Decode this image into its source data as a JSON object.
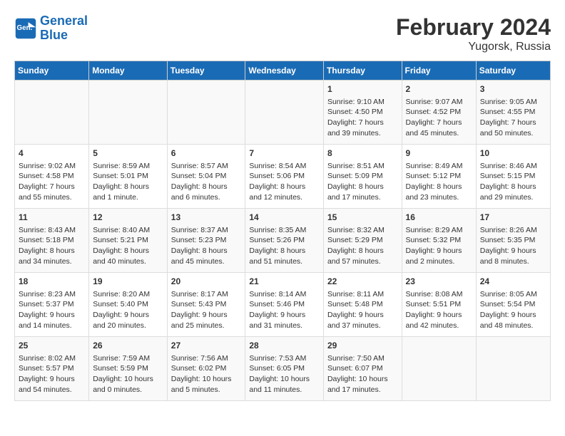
{
  "header": {
    "logo_line1": "General",
    "logo_line2": "Blue",
    "title": "February 2024",
    "subtitle": "Yugorsk, Russia"
  },
  "days_of_week": [
    "Sunday",
    "Monday",
    "Tuesday",
    "Wednesday",
    "Thursday",
    "Friday",
    "Saturday"
  ],
  "weeks": [
    [
      {
        "day": "",
        "info": ""
      },
      {
        "day": "",
        "info": ""
      },
      {
        "day": "",
        "info": ""
      },
      {
        "day": "",
        "info": ""
      },
      {
        "day": "1",
        "info": "Sunrise: 9:10 AM\nSunset: 4:50 PM\nDaylight: 7 hours\nand 39 minutes."
      },
      {
        "day": "2",
        "info": "Sunrise: 9:07 AM\nSunset: 4:52 PM\nDaylight: 7 hours\nand 45 minutes."
      },
      {
        "day": "3",
        "info": "Sunrise: 9:05 AM\nSunset: 4:55 PM\nDaylight: 7 hours\nand 50 minutes."
      }
    ],
    [
      {
        "day": "4",
        "info": "Sunrise: 9:02 AM\nSunset: 4:58 PM\nDaylight: 7 hours\nand 55 minutes."
      },
      {
        "day": "5",
        "info": "Sunrise: 8:59 AM\nSunset: 5:01 PM\nDaylight: 8 hours\nand 1 minute."
      },
      {
        "day": "6",
        "info": "Sunrise: 8:57 AM\nSunset: 5:04 PM\nDaylight: 8 hours\nand 6 minutes."
      },
      {
        "day": "7",
        "info": "Sunrise: 8:54 AM\nSunset: 5:06 PM\nDaylight: 8 hours\nand 12 minutes."
      },
      {
        "day": "8",
        "info": "Sunrise: 8:51 AM\nSunset: 5:09 PM\nDaylight: 8 hours\nand 17 minutes."
      },
      {
        "day": "9",
        "info": "Sunrise: 8:49 AM\nSunset: 5:12 PM\nDaylight: 8 hours\nand 23 minutes."
      },
      {
        "day": "10",
        "info": "Sunrise: 8:46 AM\nSunset: 5:15 PM\nDaylight: 8 hours\nand 29 minutes."
      }
    ],
    [
      {
        "day": "11",
        "info": "Sunrise: 8:43 AM\nSunset: 5:18 PM\nDaylight: 8 hours\nand 34 minutes."
      },
      {
        "day": "12",
        "info": "Sunrise: 8:40 AM\nSunset: 5:21 PM\nDaylight: 8 hours\nand 40 minutes."
      },
      {
        "day": "13",
        "info": "Sunrise: 8:37 AM\nSunset: 5:23 PM\nDaylight: 8 hours\nand 45 minutes."
      },
      {
        "day": "14",
        "info": "Sunrise: 8:35 AM\nSunset: 5:26 PM\nDaylight: 8 hours\nand 51 minutes."
      },
      {
        "day": "15",
        "info": "Sunrise: 8:32 AM\nSunset: 5:29 PM\nDaylight: 8 hours\nand 57 minutes."
      },
      {
        "day": "16",
        "info": "Sunrise: 8:29 AM\nSunset: 5:32 PM\nDaylight: 9 hours\nand 2 minutes."
      },
      {
        "day": "17",
        "info": "Sunrise: 8:26 AM\nSunset: 5:35 PM\nDaylight: 9 hours\nand 8 minutes."
      }
    ],
    [
      {
        "day": "18",
        "info": "Sunrise: 8:23 AM\nSunset: 5:37 PM\nDaylight: 9 hours\nand 14 minutes."
      },
      {
        "day": "19",
        "info": "Sunrise: 8:20 AM\nSunset: 5:40 PM\nDaylight: 9 hours\nand 20 minutes."
      },
      {
        "day": "20",
        "info": "Sunrise: 8:17 AM\nSunset: 5:43 PM\nDaylight: 9 hours\nand 25 minutes."
      },
      {
        "day": "21",
        "info": "Sunrise: 8:14 AM\nSunset: 5:46 PM\nDaylight: 9 hours\nand 31 minutes."
      },
      {
        "day": "22",
        "info": "Sunrise: 8:11 AM\nSunset: 5:48 PM\nDaylight: 9 hours\nand 37 minutes."
      },
      {
        "day": "23",
        "info": "Sunrise: 8:08 AM\nSunset: 5:51 PM\nDaylight: 9 hours\nand 42 minutes."
      },
      {
        "day": "24",
        "info": "Sunrise: 8:05 AM\nSunset: 5:54 PM\nDaylight: 9 hours\nand 48 minutes."
      }
    ],
    [
      {
        "day": "25",
        "info": "Sunrise: 8:02 AM\nSunset: 5:57 PM\nDaylight: 9 hours\nand 54 minutes."
      },
      {
        "day": "26",
        "info": "Sunrise: 7:59 AM\nSunset: 5:59 PM\nDaylight: 10 hours\nand 0 minutes."
      },
      {
        "day": "27",
        "info": "Sunrise: 7:56 AM\nSunset: 6:02 PM\nDaylight: 10 hours\nand 5 minutes."
      },
      {
        "day": "28",
        "info": "Sunrise: 7:53 AM\nSunset: 6:05 PM\nDaylight: 10 hours\nand 11 minutes."
      },
      {
        "day": "29",
        "info": "Sunrise: 7:50 AM\nSunset: 6:07 PM\nDaylight: 10 hours\nand 17 minutes."
      },
      {
        "day": "",
        "info": ""
      },
      {
        "day": "",
        "info": ""
      }
    ]
  ]
}
